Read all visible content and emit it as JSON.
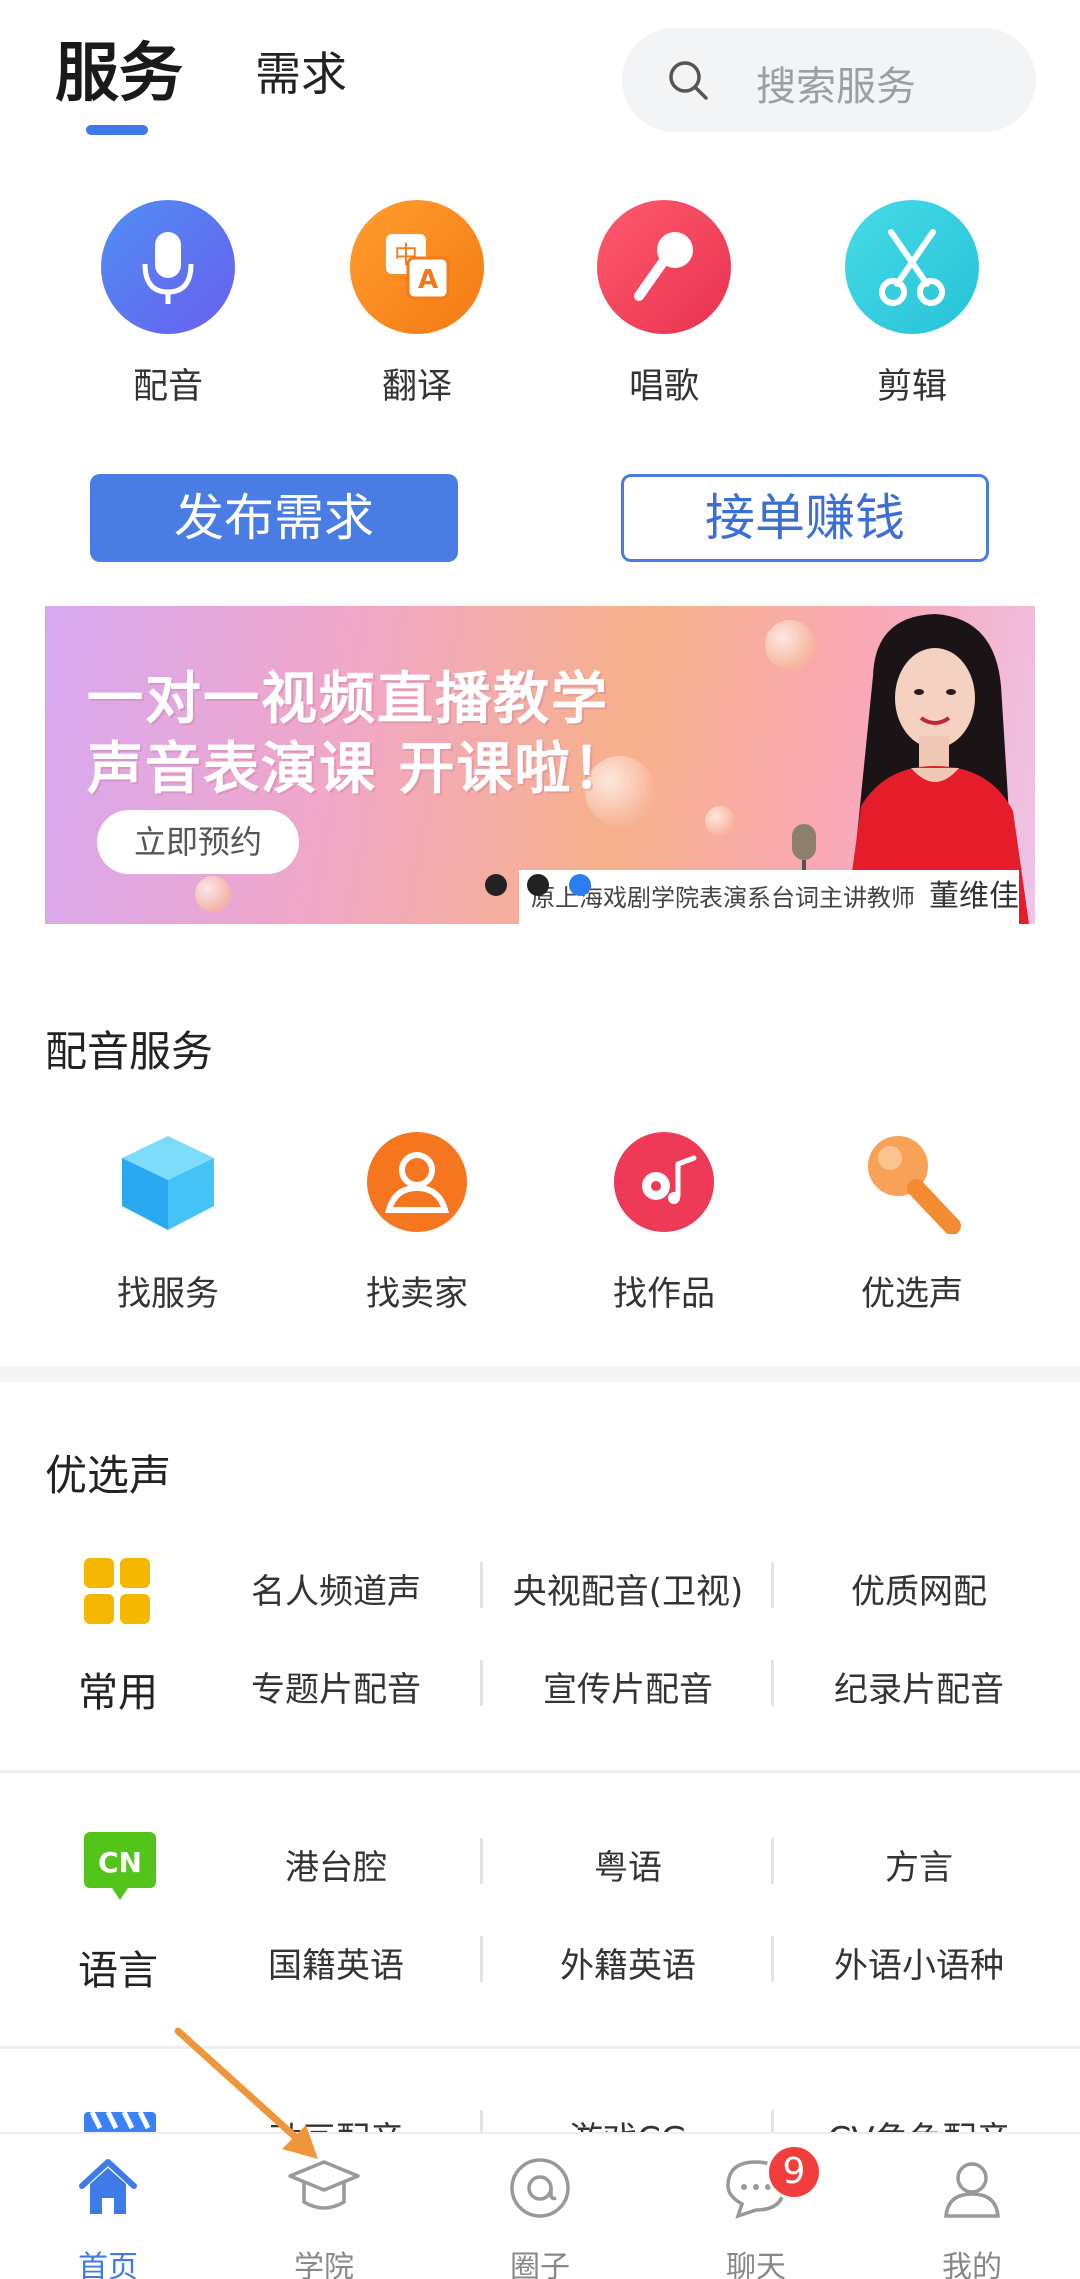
{
  "header": {
    "tab_active": "服务",
    "tab_other": "需求",
    "search_placeholder": "搜索服务"
  },
  "categories": [
    {
      "label": "配音",
      "icon": "microphone-icon",
      "color": "#5b73f0"
    },
    {
      "label": "翻译",
      "icon": "translate-icon",
      "color": "#f98a1e"
    },
    {
      "label": "唱歌",
      "icon": "karaoke-mic-icon",
      "color": "#f0455f"
    },
    {
      "label": "剪辑",
      "icon": "scissors-icon",
      "color": "#34cfe0"
    }
  ],
  "actions": {
    "publish": "发布需求",
    "earn": "接单赚钱"
  },
  "banner": {
    "line1": "一对一视频直播教学",
    "line2": "声音表演课 开课啦！",
    "button": "立即预约",
    "caption": "原上海戏剧学院表演系台词主讲教师",
    "teacher": "董维佳",
    "slide_count": 3,
    "active_slide": 3
  },
  "dubbing_service": {
    "title": "配音服务",
    "items": [
      {
        "label": "找服务",
        "icon": "cube-icon"
      },
      {
        "label": "找卖家",
        "icon": "person-icon"
      },
      {
        "label": "找作品",
        "icon": "music-disc-icon"
      },
      {
        "label": "优选声",
        "icon": "microphone-icon"
      }
    ]
  },
  "preferred_voice": {
    "title": "优选声",
    "groups": [
      {
        "label": "常用",
        "icon": "grid-icon",
        "items": [
          "名人频道声",
          "央视配音(卫视)",
          "优质网配",
          "专题片配音",
          "宣传片配音",
          "纪录片配音"
        ]
      },
      {
        "label": "语言",
        "icon": "cn-icon",
        "icon_text": "CN",
        "items": [
          "港台腔",
          "粤语",
          "方言",
          "国籍英语",
          "外籍英语",
          "外语小语种"
        ]
      },
      {
        "label": "",
        "icon": "clapperboard-icon",
        "items": [
          "动画配音",
          "游戏CG",
          "CV角色配音"
        ]
      }
    ]
  },
  "bottom_nav": [
    {
      "label": "首页",
      "icon": "home-icon",
      "active": true
    },
    {
      "label": "学院",
      "icon": "graduation-cap-icon",
      "active": false
    },
    {
      "label": "圈子",
      "icon": "circle-at-icon",
      "active": false
    },
    {
      "label": "聊天",
      "icon": "chat-icon",
      "active": false,
      "badge": "9"
    },
    {
      "label": "我的",
      "icon": "user-icon",
      "active": false
    }
  ],
  "colors": {
    "accent": "#3f7be6",
    "annotation_arrow": "#f0963a"
  }
}
